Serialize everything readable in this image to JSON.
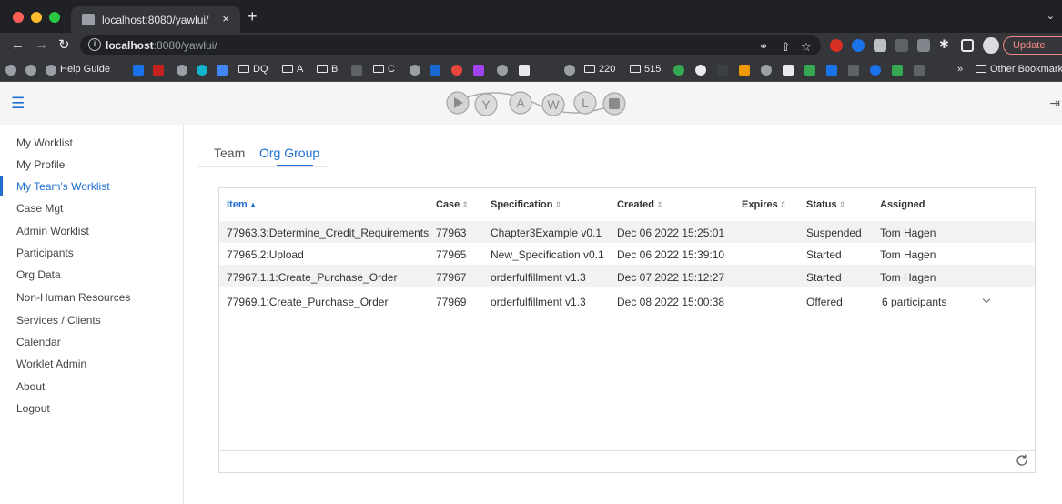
{
  "browser": {
    "tab_title": "localhost:8080/yawlui/",
    "tab_close": "×",
    "new_tab": "+",
    "url_host": "localhost",
    "url_rest": ":8080/yawlui/",
    "update_label": "Update",
    "bookmarks": {
      "help_guide": "Help Guide",
      "dq": "DQ",
      "a": "A",
      "b": "B",
      "c": "C",
      "n220": "220",
      "n515": "515",
      "overflow": "»",
      "other": "Other Bookmarks"
    }
  },
  "app": {
    "logo_letters": [
      "Y",
      "A",
      "W",
      "L"
    ],
    "sidebar": {
      "items": [
        {
          "label": "My Worklist"
        },
        {
          "label": "My Profile"
        },
        {
          "label": "My Team's Worklist"
        },
        {
          "label": "Case Mgt"
        },
        {
          "label": "Admin Worklist"
        },
        {
          "label": "Participants"
        },
        {
          "label": "Org Data"
        },
        {
          "label": "Non-Human Resources"
        },
        {
          "label": "Services / Clients"
        },
        {
          "label": "Calendar"
        },
        {
          "label": "Worklet Admin"
        },
        {
          "label": "About"
        },
        {
          "label": "Logout"
        }
      ],
      "active_index": 2
    },
    "tabs": [
      {
        "label": "Team"
      },
      {
        "label": "Org Group"
      }
    ],
    "table": {
      "columns": [
        "Item",
        "Case",
        "Specification",
        "Created",
        "Expires",
        "Status",
        "Assigned"
      ],
      "sort_asc_icon": "▲",
      "sort_icon": "⇕",
      "rows": [
        {
          "item": "77963.3:Determine_Credit_Requirements",
          "case": "77963",
          "spec": "Chapter3Example v0.1",
          "created": "Dec 06 2022 15:25:01",
          "expires": "",
          "status": "Suspended",
          "assigned": "Tom Hagen"
        },
        {
          "item": "77965.2:Upload",
          "case": "77965",
          "spec": "New_Specification v0.1",
          "created": "Dec 06 2022 15:39:10",
          "expires": "",
          "status": "Started",
          "assigned": "Tom Hagen"
        },
        {
          "item": "77967.1.1:Create_Purchase_Order",
          "case": "77967",
          "spec": "orderfulfillment v1.3",
          "created": "Dec 07 2022 15:12:27",
          "expires": "",
          "status": "Started",
          "assigned": "Tom Hagen"
        },
        {
          "item": "77969.1:Create_Purchase_Order",
          "case": "77969",
          "spec": "orderfulfillment v1.3",
          "created": "Dec 08 2022 15:00:38",
          "expires": "",
          "status": "Offered",
          "assigned": "6 participants"
        }
      ]
    }
  },
  "colors": {
    "accent": "#1f6fd1",
    "chrome_dark": "#202124",
    "chrome_mid": "#35363a"
  }
}
